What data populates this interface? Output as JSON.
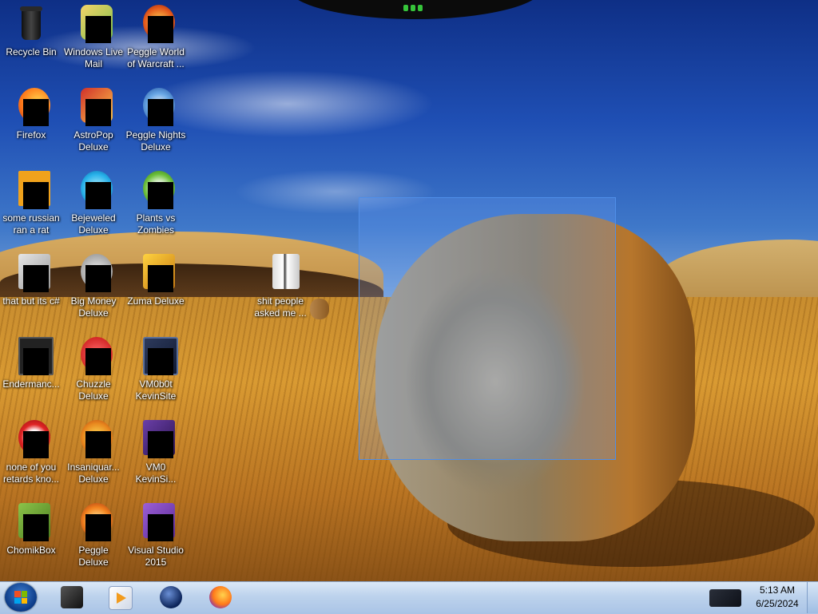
{
  "desktop": {
    "icons": [
      {
        "label": "Recycle Bin",
        "icon": "recycle-bin-icon"
      },
      {
        "label": "Windows Live\nMail",
        "icon": "mail-icon"
      },
      {
        "label": "Peggle World\nof Warcraft ...",
        "icon": "peggle-icon"
      },
      {
        "label": "Firefox",
        "icon": "firefox-icon"
      },
      {
        "label": "AstroPop\nDeluxe",
        "icon": "game-icon"
      },
      {
        "label": "Peggle Nights\nDeluxe",
        "icon": "peggle-icon"
      },
      {
        "label": "some russian\nran a rat",
        "icon": "app-icon"
      },
      {
        "label": "Bejeweled\nDeluxe",
        "icon": "gem-icon"
      },
      {
        "label": "Plants vs\nZombies",
        "icon": "plant-icon"
      },
      {
        "label": "that but its c#",
        "icon": "file-icon"
      },
      {
        "label": "Big Money\nDeluxe",
        "icon": "game-icon"
      },
      {
        "label": "Zuma Deluxe",
        "icon": "game-icon"
      },
      {
        "label": "shit people\nasked me ...",
        "icon": "folder-icon"
      },
      {
        "label": "Endermanc...",
        "icon": "app-icon"
      },
      {
        "label": "Chuzzle\nDeluxe",
        "icon": "game-icon"
      },
      {
        "label": "VM0b0t\nKevinSite",
        "icon": "monitor-icon"
      },
      {
        "label": "none of you\nretards kno...",
        "icon": "app-icon"
      },
      {
        "label": "Insaniquar...\nDeluxe",
        "icon": "fish-icon"
      },
      {
        "label": "VM0\nKevinSi...",
        "icon": "app-icon"
      },
      {
        "label": "ChomikBox",
        "icon": "app-icon"
      },
      {
        "label": "Peggle Deluxe",
        "icon": "peggle-icon"
      },
      {
        "label": "Visual Studio\n2015",
        "icon": "visual-studio-icon"
      }
    ]
  },
  "taskbar": {
    "start_label": "Start",
    "pinned": [
      {
        "name": "computer",
        "icon": "computer-icon"
      },
      {
        "name": "media-player",
        "icon": "media-player-icon"
      },
      {
        "name": "globe-app",
        "icon": "globe-icon"
      },
      {
        "name": "firefox",
        "icon": "firefox-icon"
      }
    ],
    "clock": {
      "time": "5:13 AM",
      "date": "6/25/2024"
    }
  },
  "colors": {
    "taskbar": "#bcd2ec",
    "selection_border": "#4f8ee8",
    "label_text": "#ffffff"
  }
}
